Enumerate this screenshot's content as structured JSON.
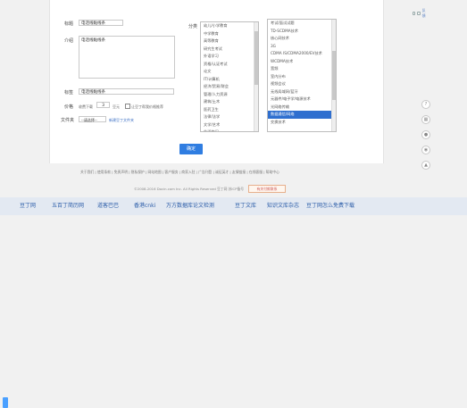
{
  "form": {
    "title_label": "标题",
    "title_value": "电话线黏线条",
    "intro_label": "介绍",
    "intro_value": "电话线黏线条",
    "tag_label": "标签",
    "tag_value": "电话线黏线条",
    "price_label": "价格",
    "price_prefix": "收费下载",
    "price_value": "3",
    "price_unit": "豆元",
    "checkbox_text": "让豆丁帮我价格推荐",
    "folder_label": "文件夹",
    "folder_value": "--请选择--",
    "folder_new_link": "新建豆丁文件夹",
    "category_label": "分类",
    "ok_button": "确定"
  },
  "topicons": {
    "link_text": "反馈"
  },
  "category_left": [
    "幼儿/小学教育",
    "中学教育",
    "高等教育",
    "研究生考试",
    "外语学习",
    "资格/认证考试",
    "论文",
    "IT/计算机",
    "经济/贸易/财会",
    "管理/人力资源",
    "建筑/土木",
    "医药卫生",
    "法律/法学",
    "文学/艺术",
    "生活休闲"
  ],
  "category_right": [
    "考试/面试试题",
    "TD-SCDMA技术",
    "核心网技术",
    "3G",
    "CDMA IS/CDMA2000/EV技术",
    "WCDMA技术",
    "宽频",
    "室内分布",
    "视频会议",
    "无线局域网/蓝牙",
    "元器件/电子学/电源技术",
    "光网络传输",
    "数据通信/网络",
    "交换技术"
  ],
  "selected_right_index": 12,
  "footer": {
    "links": "关于我们 | 使用条款 | 免责声明 | 隐私保护 | 网站地图 | 客户服务 | 商家入驻 | 广告刊登 | 诚征英才 | 友情链接 | 在线客服 | 帮助中心",
    "copyright": "©2008-2016 Docin.com Inc. All Rights Reserved 豆丁网 苏ICP备号",
    "badge": "有关付款联系"
  },
  "bottombar": [
    "豆丁网",
    "五百丁简历网",
    "道客巴巴",
    "香港cnki",
    "万方数据库论文检测",
    "豆丁文库",
    "知识文库杂志",
    "豆丁网怎么免费下载"
  ]
}
